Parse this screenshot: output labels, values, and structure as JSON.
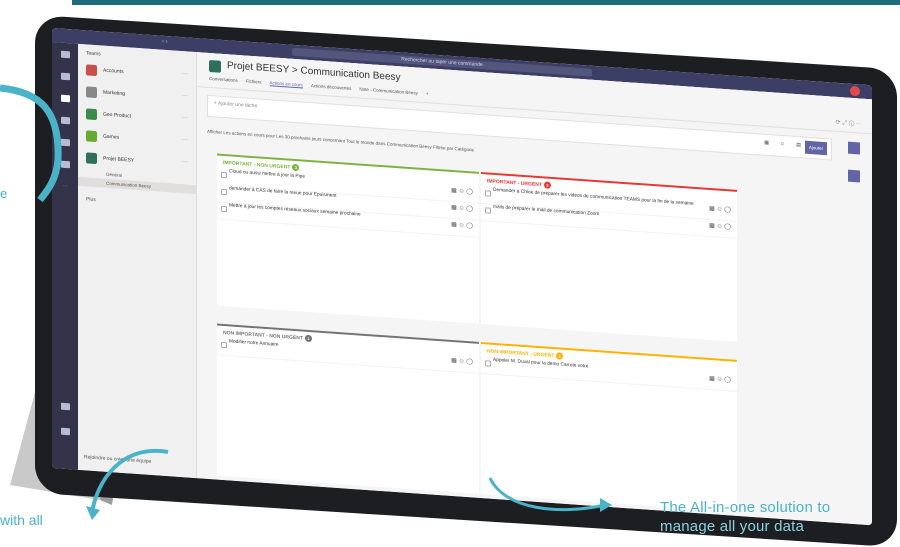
{
  "captions": {
    "right_line1": "The All-in-one solution to",
    "right_line2": "manage all your data",
    "left": "with all",
    "edge": "e"
  },
  "app": {
    "search_placeholder": "Rechercher ou taper une commande",
    "sidebar_header": "Teams",
    "teams": [
      {
        "name": "Accounts",
        "color": "#c94f4f"
      },
      {
        "name": "Marketing",
        "color": "#888888"
      },
      {
        "name": "Geo Product",
        "color": "#3c8b4a"
      },
      {
        "name": "Games",
        "color": "#66aa33"
      },
      {
        "name": "Projet BEESY",
        "color": "#2f6f5f"
      }
    ],
    "subchannels": [
      "Général",
      "Communication Beesy"
    ],
    "sidebar_more": "Plus",
    "sidebar_join": "Rejoindre ou créer une équipe",
    "channel_title": "Projet BEESY > Communication Beesy",
    "tabs": [
      "Conversations",
      "Fichiers",
      "Actions en cours",
      "Actions découvertes",
      "Note - Communication Beesy",
      "+"
    ],
    "add_placeholder": "+ Ajouter une tâche",
    "save_label": "Ajouter",
    "filters_text": "Afficher  Les actions en cours  pour  Les 30 prochains jours  concernant  Tout le monde  dans  Communication Beesy  Filtrée par  Catégorie"
  },
  "quadrants": [
    {
      "title": "IMPORTANT - NON URGENT",
      "count": "3",
      "color": "#7cb342",
      "tasks": [
        "Cloud ou aussi mettre à jour la Pipe",
        "demander à CAS de faire la revue pour Epuisment",
        "Mettre à jour les comptes réseaux sociaux semaine prochaine"
      ]
    },
    {
      "title": "IMPORTANT - URGENT",
      "count": "2",
      "color": "#e53935",
      "tasks": [
        "Demander à Chloé de préparer les vidéos de communication TEAMS pour la fin de la semaine",
        "mails de préparer le mail de communication Zoom"
      ]
    },
    {
      "title": "NON IMPORTANT - NON URGENT",
      "count": "1",
      "color": "#757575",
      "tasks": [
        "Modifier notre Annuaire"
      ]
    },
    {
      "title": "NON IMPORTANT - URGENT",
      "count": "1",
      "color": "#ffb300",
      "tasks": [
        "Appeler M. Duval pour la demo Carrote votre"
      ]
    }
  ]
}
